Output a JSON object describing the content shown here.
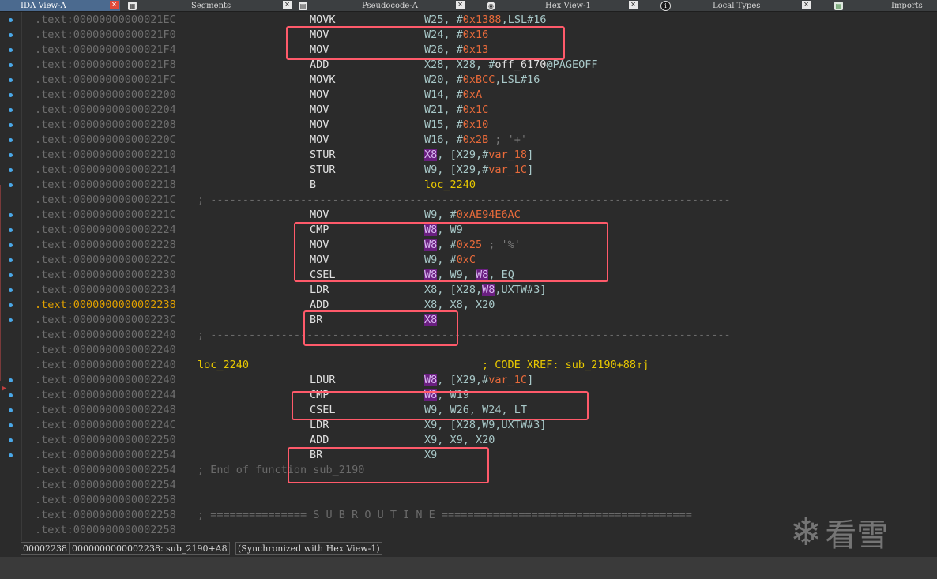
{
  "tabs": [
    {
      "label": "IDA View-A",
      "icon": "",
      "active": true
    },
    {
      "label": "Segments",
      "icon": "table-icon"
    },
    {
      "label": "Pseudocode-A",
      "icon": "document-icon"
    },
    {
      "label": "Hex View-1",
      "icon": "hex-icon"
    },
    {
      "label": "Local Types",
      "icon": "info-icon"
    },
    {
      "label": "Imports",
      "icon": "imports-icon"
    }
  ],
  "close_glyph": "×",
  "lines": [
    {
      "addr": ".text:00000000000021EC",
      "mn": "MOVK",
      "ops": [
        {
          "t": "W25, #",
          "c": "reg"
        },
        {
          "t": "0x1388",
          "c": "num"
        },
        {
          "t": ",LSL#16",
          "c": "reg"
        }
      ]
    },
    {
      "addr": ".text:00000000000021F0",
      "mn": "MOV",
      "ops": [
        {
          "t": "W24, #",
          "c": "reg"
        },
        {
          "t": "0x16",
          "c": "num"
        }
      ]
    },
    {
      "addr": ".text:00000000000021F4",
      "mn": "MOV",
      "ops": [
        {
          "t": "W26, #",
          "c": "reg"
        },
        {
          "t": "0x13",
          "c": "num"
        }
      ]
    },
    {
      "addr": ".text:00000000000021F8",
      "mn": "ADD",
      "ops": [
        {
          "t": "X28, X28, #",
          "c": "reg"
        },
        {
          "t": "off_6170",
          "c": "white"
        },
        {
          "t": "@PAGEOFF",
          "c": "reg"
        }
      ]
    },
    {
      "addr": ".text:00000000000021FC",
      "mn": "MOVK",
      "ops": [
        {
          "t": "W20, #",
          "c": "reg"
        },
        {
          "t": "0xBCC",
          "c": "num"
        },
        {
          "t": ",LSL#16",
          "c": "reg"
        }
      ]
    },
    {
      "addr": ".text:0000000000002200",
      "mn": "MOV",
      "ops": [
        {
          "t": "W14, #",
          "c": "reg"
        },
        {
          "t": "0xA",
          "c": "num"
        }
      ]
    },
    {
      "addr": ".text:0000000000002204",
      "mn": "MOV",
      "ops": [
        {
          "t": "W21, #",
          "c": "reg"
        },
        {
          "t": "0x1C",
          "c": "num"
        }
      ]
    },
    {
      "addr": ".text:0000000000002208",
      "mn": "MOV",
      "ops": [
        {
          "t": "W15, #",
          "c": "reg"
        },
        {
          "t": "0x10",
          "c": "num"
        }
      ]
    },
    {
      "addr": ".text:000000000000220C",
      "mn": "MOV",
      "ops": [
        {
          "t": "W16, #",
          "c": "reg"
        },
        {
          "t": "0x2B",
          "c": "num"
        },
        {
          "t": " ; '+'",
          "c": "str"
        }
      ]
    },
    {
      "addr": ".text:0000000000002210",
      "mn": "STUR",
      "ops": [
        {
          "t": "X8",
          "c": "hl"
        },
        {
          "t": ", [X29,#",
          "c": "reg"
        },
        {
          "t": "var_18",
          "c": "var"
        },
        {
          "t": "]",
          "c": "reg"
        }
      ]
    },
    {
      "addr": ".text:0000000000002214",
      "mn": "STUR",
      "ops": [
        {
          "t": "W9",
          "c": "reg"
        },
        {
          "t": ", [X29,#",
          "c": "reg"
        },
        {
          "t": "var_1C",
          "c": "var"
        },
        {
          "t": "]",
          "c": "reg"
        }
      ]
    },
    {
      "addr": ".text:0000000000002218",
      "mn": "B",
      "ops": [
        {
          "t": "loc_2240",
          "c": "name"
        }
      ]
    },
    {
      "addr": ".text:000000000000221C",
      "sep": "; ---------------------------------------------------------------------------------"
    },
    {
      "addr": ".text:000000000000221C",
      "mn": "MOV",
      "ops": [
        {
          "t": "W9, #",
          "c": "reg"
        },
        {
          "t": "0xAE94E6AC",
          "c": "num"
        }
      ]
    },
    {
      "addr": ".text:0000000000002224",
      "mn": "CMP",
      "ops": [
        {
          "t": "W8",
          "c": "hl"
        },
        {
          "t": ", W9",
          "c": "reg"
        }
      ]
    },
    {
      "addr": ".text:0000000000002228",
      "mn": "MOV",
      "ops": [
        {
          "t": "W8",
          "c": "hl"
        },
        {
          "t": ", #",
          "c": "reg"
        },
        {
          "t": "0x25",
          "c": "num"
        },
        {
          "t": " ; '%'",
          "c": "str"
        }
      ]
    },
    {
      "addr": ".text:000000000000222C",
      "mn": "MOV",
      "ops": [
        {
          "t": "W9, #",
          "c": "reg"
        },
        {
          "t": "0xC",
          "c": "num"
        }
      ]
    },
    {
      "addr": ".text:0000000000002230",
      "mn": "CSEL",
      "ops": [
        {
          "t": "W8",
          "c": "hl"
        },
        {
          "t": ", W9, ",
          "c": "reg"
        },
        {
          "t": "W8",
          "c": "hl"
        },
        {
          "t": ", EQ",
          "c": "reg"
        }
      ]
    },
    {
      "addr": ".text:0000000000002234",
      "mn": "LDR",
      "ops": [
        {
          "t": "X8, [X28,",
          "c": "reg"
        },
        {
          "t": "W8",
          "c": "hl"
        },
        {
          "t": ",UXTW#3]",
          "c": "reg"
        }
      ]
    },
    {
      "addr": ".text:0000000000002238",
      "cur": true,
      "mn": "ADD",
      "ops": [
        {
          "t": "X8, X8, X20",
          "c": "reg"
        }
      ]
    },
    {
      "addr": ".text:000000000000223C",
      "mn": "BR",
      "ops": [
        {
          "t": "X8",
          "c": "hl"
        }
      ]
    },
    {
      "addr": ".text:0000000000002240",
      "sep": "; ---------------------------------------------------------------------------------"
    },
    {
      "addr": ".text:0000000000002240"
    },
    {
      "addr": ".text:0000000000002240",
      "label": "loc_2240",
      "xref": "; CODE XREF: sub_2190+88↑j"
    },
    {
      "addr": ".text:0000000000002240",
      "mn": "LDUR",
      "ops": [
        {
          "t": "W8",
          "c": "hl"
        },
        {
          "t": ", [X29,#",
          "c": "reg"
        },
        {
          "t": "var_1C",
          "c": "var"
        },
        {
          "t": "]",
          "c": "reg"
        }
      ]
    },
    {
      "addr": ".text:0000000000002244",
      "mn": "CMP",
      "ops": [
        {
          "t": "W8",
          "c": "hl"
        },
        {
          "t": ", W19",
          "c": "reg"
        }
      ]
    },
    {
      "addr": ".text:0000000000002248",
      "mn": "CSEL",
      "ops": [
        {
          "t": "W9, W26, W24, LT",
          "c": "reg"
        }
      ]
    },
    {
      "addr": ".text:000000000000224C",
      "mn": "LDR",
      "ops": [
        {
          "t": "X9, [X28,W9,UXTW#3]",
          "c": "reg"
        }
      ]
    },
    {
      "addr": ".text:0000000000002250",
      "mn": "ADD",
      "ops": [
        {
          "t": "X9, X9, X20",
          "c": "reg"
        }
      ]
    },
    {
      "addr": ".text:0000000000002254",
      "mn": "BR",
      "ops": [
        {
          "t": "X9",
          "c": "reg"
        }
      ]
    },
    {
      "addr": ".text:0000000000002254",
      "sep": "; End of function sub_2190"
    },
    {
      "addr": ".text:0000000000002254"
    },
    {
      "addr": ".text:0000000000002258"
    },
    {
      "addr": ".text:0000000000002258",
      "sep": "; =============== S U B R O U T I N E ======================================="
    },
    {
      "addr": ".text:0000000000002258"
    }
  ],
  "status": {
    "offset": "00002238",
    "location": "0000000000002238: sub_2190+A8",
    "sync": "(Synchronized with Hex View-1)"
  },
  "watermark": {
    "icon": "snowflake-icon",
    "text": "看雪"
  },
  "colors": {
    "accent_box": "#ff5a6a",
    "register_highlight": "#6a1f80",
    "number": "#e86a3a",
    "label": "#e8c800"
  }
}
